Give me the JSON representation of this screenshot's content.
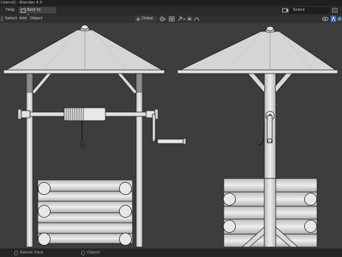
{
  "titlebar": {
    "title": "f.blend] - Blender 4.0"
  },
  "topbar": {
    "help_menu": "Help",
    "back_button": "Back to Previous",
    "scene_label": "Scene"
  },
  "header": {
    "select_menu": "Select",
    "add_menu": "Add",
    "object_menu": "Object",
    "transform_orientation": "Global"
  },
  "status": {
    "hint_rotate": "Rotate View",
    "hint_object": "Object"
  },
  "colors": {
    "viewport_bg": "#3d3d3d",
    "model_fill": "#d9d9d9",
    "model_line": "#1c1c1c"
  },
  "icons": [
    "fullscreen-icon",
    "scene-icon",
    "snap-icon",
    "pivot-icon",
    "gizmo-icon",
    "mouse-icon"
  ]
}
